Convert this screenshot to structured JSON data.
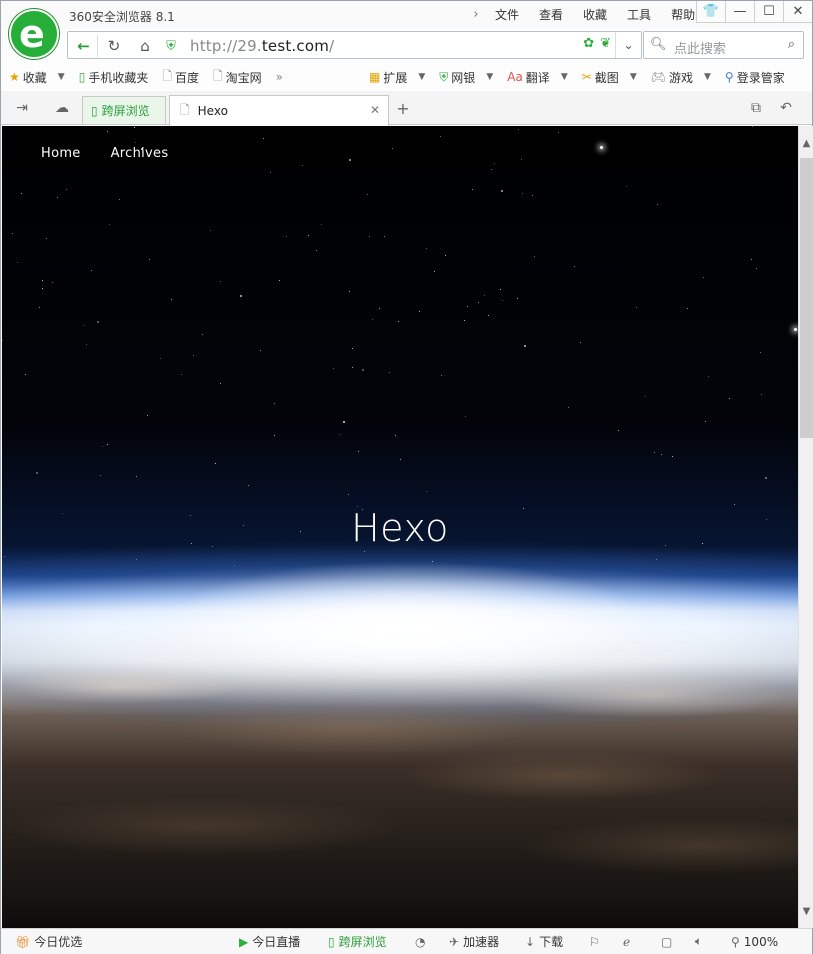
{
  "app": {
    "title": "360安全浏览器 8.1"
  },
  "menu": [
    "文件",
    "查看",
    "收藏",
    "工具",
    "帮助"
  ],
  "address": {
    "prefix": "http://29.",
    "host": "test.com",
    "suffix": "/"
  },
  "search": {
    "placeholder": "点此搜索"
  },
  "bookmarks": {
    "left": [
      {
        "label": "收藏",
        "icon": "star-icon"
      },
      {
        "label": "手机收藏夹",
        "icon": "phone-icon"
      },
      {
        "label": "百度",
        "icon": "page-icon"
      },
      {
        "label": "淘宝网",
        "icon": "page-icon"
      }
    ],
    "right": [
      {
        "label": "扩展",
        "icon": "extensions-icon"
      },
      {
        "label": "网银",
        "icon": "bank-icon"
      },
      {
        "label": "翻译",
        "icon": "translate-icon"
      },
      {
        "label": "截图",
        "icon": "screenshot-icon"
      },
      {
        "label": "游戏",
        "icon": "game-icon"
      },
      {
        "label": "登录管家",
        "icon": "login-icon"
      }
    ]
  },
  "tabs": {
    "cross_screen": "跨屏浏览",
    "active": "Hexo"
  },
  "site": {
    "nav": [
      "Home",
      "Archives"
    ],
    "title": "Hexo"
  },
  "status": {
    "today_pick": "今日优选",
    "today_live": "今日直播",
    "cross_screen": "跨屏浏览",
    "accelerator": "加速器",
    "download": "下载",
    "zoom": "100%"
  },
  "colors": {
    "accent": "#2fae3d",
    "logo": "#27ae38"
  }
}
